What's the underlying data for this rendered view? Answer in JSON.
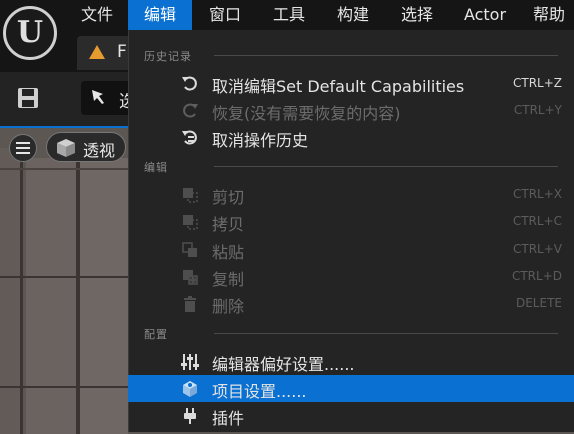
{
  "menubar": {
    "items": [
      {
        "label": "文件"
      },
      {
        "label": "编辑"
      },
      {
        "label": "窗口"
      },
      {
        "label": "工具"
      },
      {
        "label": "构建"
      },
      {
        "label": "选择"
      },
      {
        "label": "Actor"
      },
      {
        "label": "帮助"
      }
    ],
    "active_index": 1
  },
  "tab": {
    "label": "F"
  },
  "toolbar": {
    "select_label": "选"
  },
  "viewport": {
    "view_label": "透视"
  },
  "menu": {
    "sections": [
      {
        "header": "历史记录",
        "items": [
          {
            "icon": "undo-icon",
            "label": "取消编辑Set Default Capabilities",
            "shortcut": "CTRL+Z",
            "enabled": true
          },
          {
            "icon": "redo-icon",
            "label": "恢复(没有需要恢复的内容)",
            "shortcut": "CTRL+Y",
            "enabled": false
          },
          {
            "icon": "undo-history-icon",
            "label": "取消操作历史",
            "shortcut": "",
            "enabled": true
          }
        ]
      },
      {
        "header": "编辑",
        "items": [
          {
            "icon": "cut-icon",
            "label": "剪切",
            "shortcut": "CTRL+X",
            "enabled": false
          },
          {
            "icon": "copy-icon",
            "label": "拷贝",
            "shortcut": "CTRL+C",
            "enabled": false
          },
          {
            "icon": "paste-icon",
            "label": "粘贴",
            "shortcut": "CTRL+V",
            "enabled": false
          },
          {
            "icon": "duplicate-icon",
            "label": "复制",
            "shortcut": "CTRL+D",
            "enabled": false
          },
          {
            "icon": "delete-icon",
            "label": "删除",
            "shortcut": "DELETE",
            "enabled": false
          }
        ]
      },
      {
        "header": "配置",
        "items": [
          {
            "icon": "editor-preferences-icon",
            "label": "编辑器偏好设置......",
            "shortcut": "",
            "enabled": true
          },
          {
            "icon": "project-settings-icon",
            "label": "项目设置......",
            "shortcut": "",
            "enabled": true,
            "highlighted": true
          },
          {
            "icon": "plugins-icon",
            "label": "插件",
            "shortcut": "",
            "enabled": true
          }
        ]
      }
    ]
  },
  "colors": {
    "accent": "#0a70d2",
    "menu_bg": "#242424",
    "disabled_text": "#6c6c6c"
  }
}
